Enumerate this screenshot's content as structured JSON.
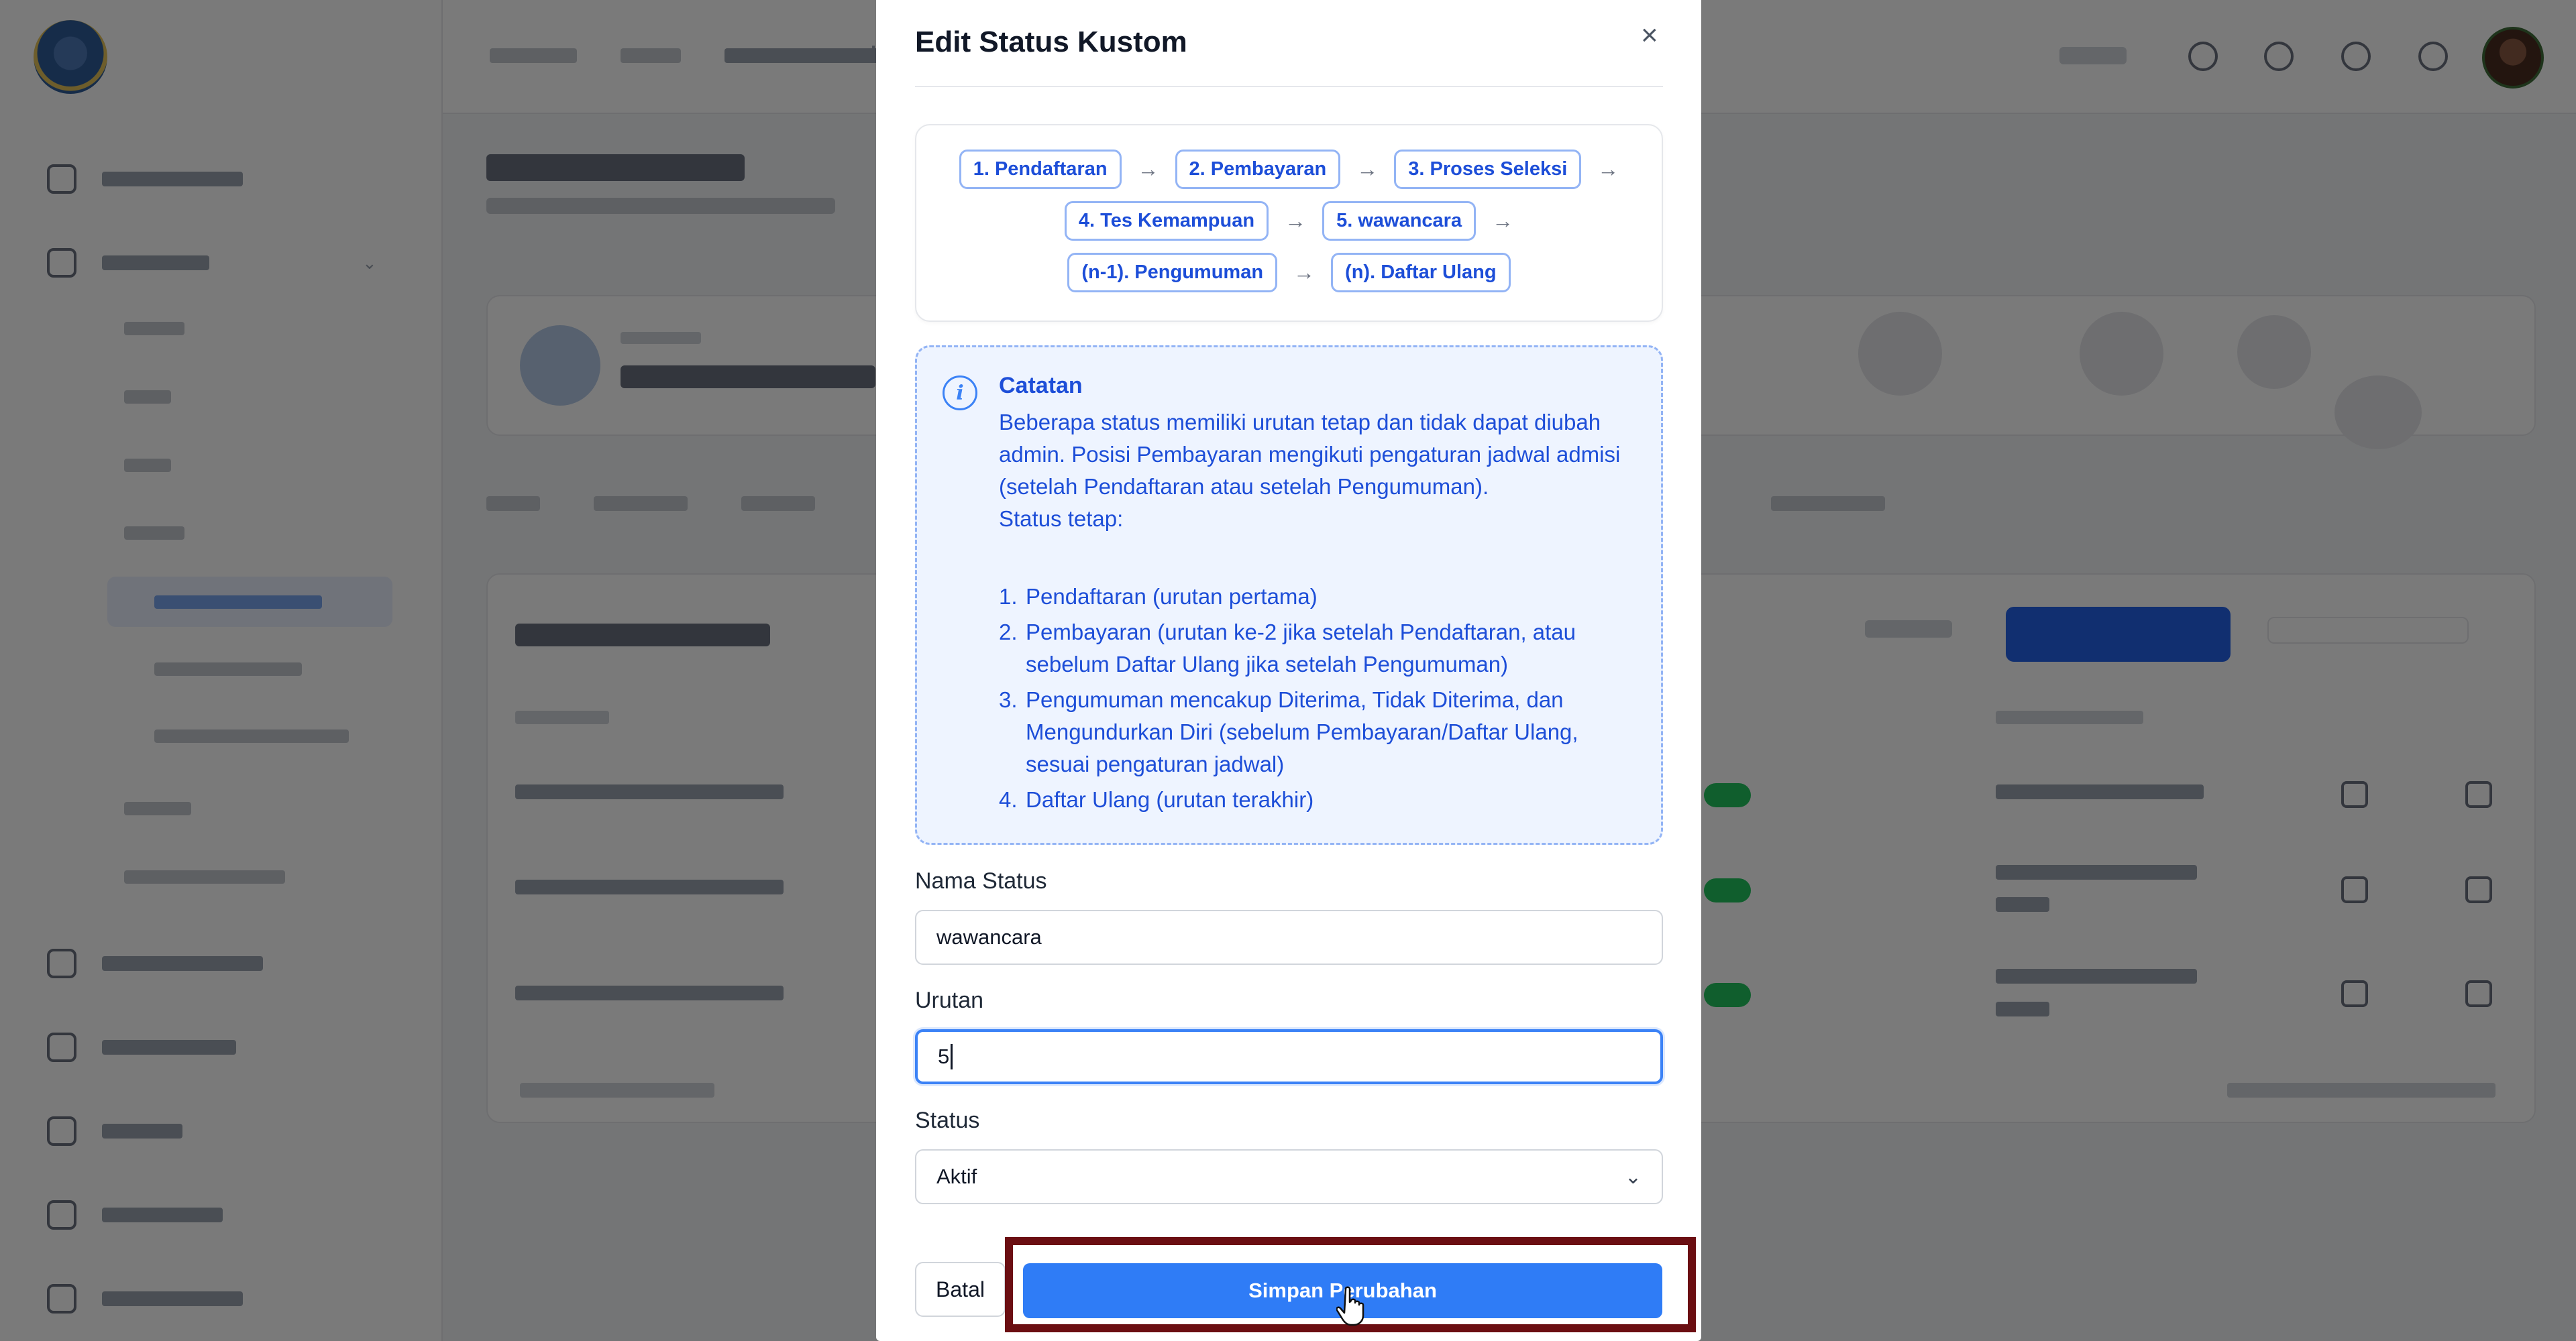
{
  "modal": {
    "title": "Edit Status Kustom",
    "close_label": "×",
    "flow_steps": [
      [
        "1. Pendaftaran",
        "2. Pembayaran",
        "3. Proses Seleksi"
      ],
      [
        "4. Tes Kemampuan",
        "5. wawancara"
      ],
      [
        "(n-1). Pengumuman",
        "(n). Daftar Ulang"
      ]
    ],
    "arrow_glyph": "→",
    "note": {
      "icon": "info-icon",
      "title": "Catatan",
      "body": "Beberapa status memiliki urutan tetap dan tidak dapat diubah admin. Posisi Pembayaran mengikuti pengaturan jadwal admisi (setelah Pendaftaran atau setelah Pengumuman).",
      "fixed_heading": "Status tetap:",
      "items": [
        {
          "num": "1.",
          "text": "Pendaftaran (urutan pertama)"
        },
        {
          "num": "2.",
          "text": "Pembayaran (urutan ke-2 jika setelah Pendaftaran, atau sebelum Daftar Ulang jika setelah Pengumuman)"
        },
        {
          "num": "3.",
          "text": "Pengumuman mencakup Diterima, Tidak Diterima, dan Mengundurkan Diri (sebelum Pembayaran/Daftar Ulang, sesuai pengaturan jadwal)"
        },
        {
          "num": "4.",
          "text": "Daftar Ulang (urutan terakhir)"
        }
      ]
    },
    "fields": {
      "nama_status": {
        "label": "Nama Status",
        "value": "wawancara"
      },
      "urutan": {
        "label": "Urutan",
        "value": "5"
      },
      "status": {
        "label": "Status",
        "value": "Aktif"
      }
    },
    "buttons": {
      "cancel": "Batal",
      "save": "Simpan Perubahan"
    }
  },
  "colors": {
    "primary": "#2f7cf6",
    "chip_text": "#1d4ed8",
    "highlight_border": "#6b0e12"
  }
}
